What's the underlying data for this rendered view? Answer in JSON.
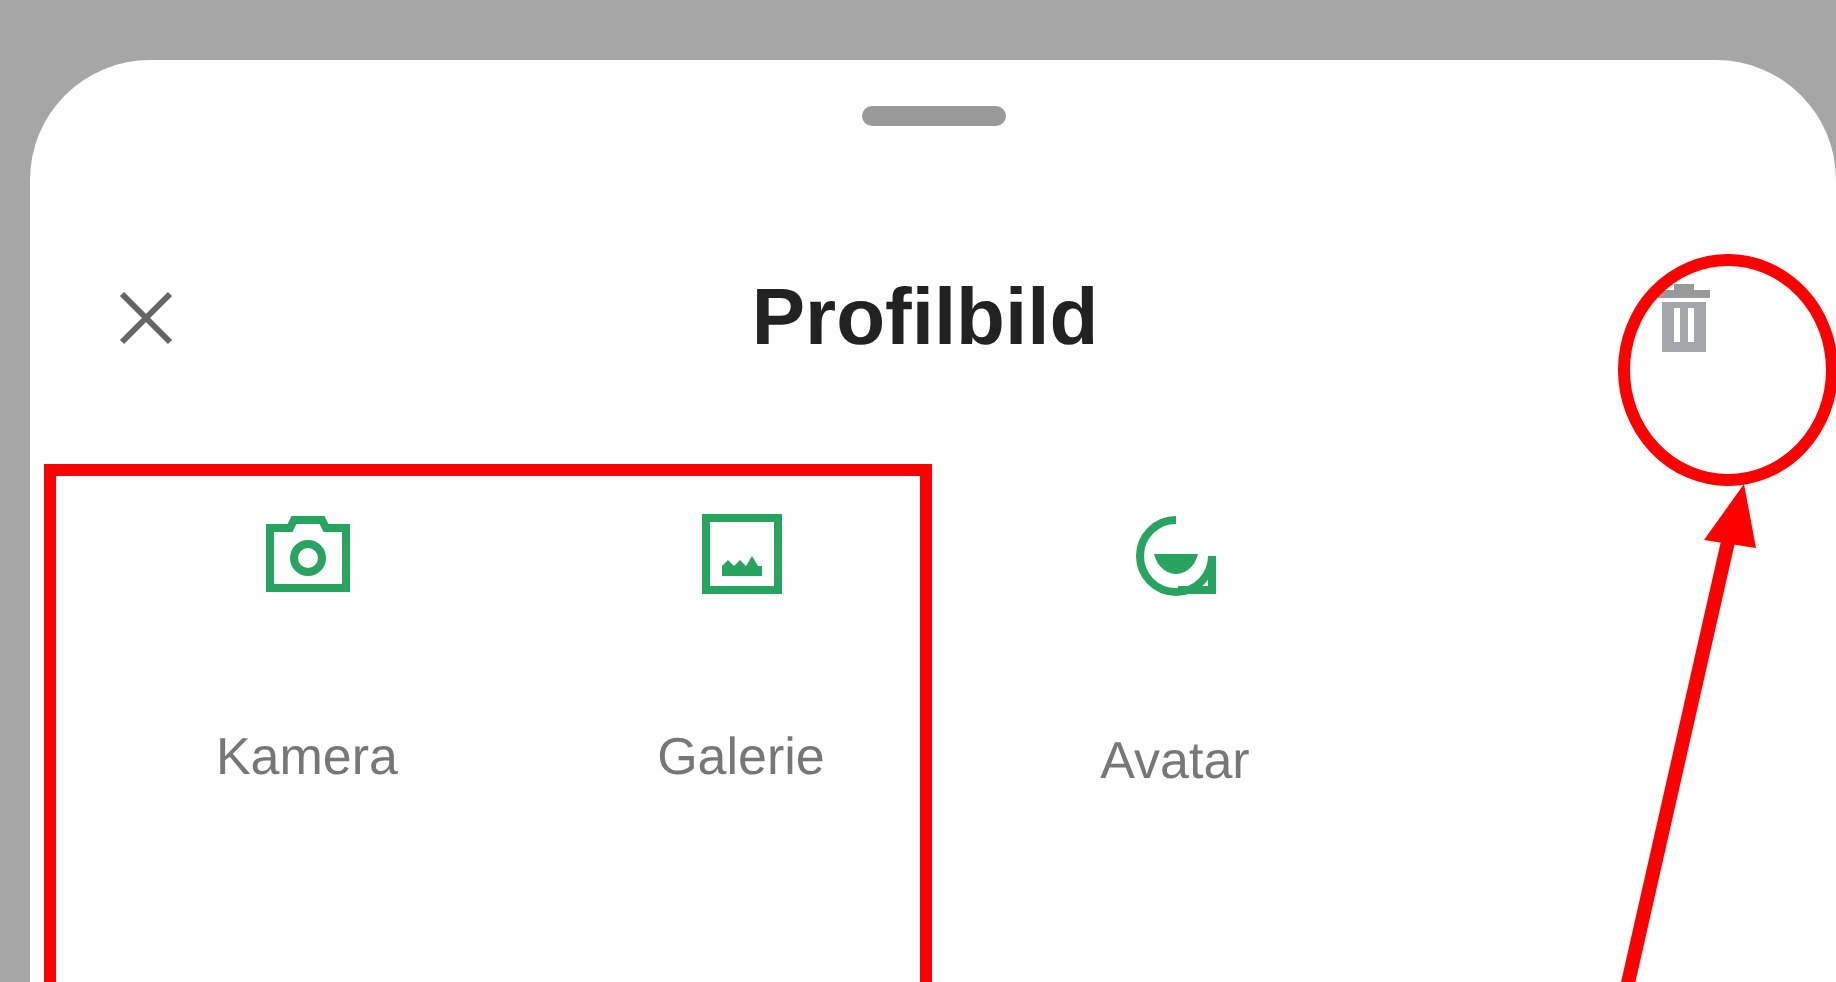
{
  "sheet": {
    "title": "Profilbild",
    "options": [
      {
        "label": "Kamera",
        "kind": "camera"
      },
      {
        "label": "Galerie",
        "kind": "gallery"
      },
      {
        "label": "Avatar",
        "kind": "avatar"
      }
    ]
  }
}
